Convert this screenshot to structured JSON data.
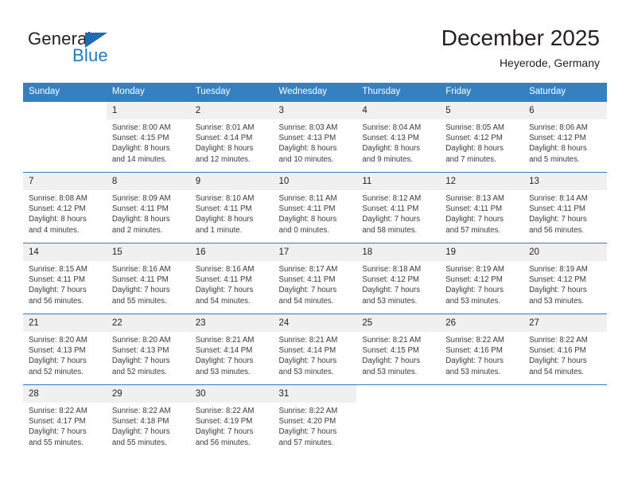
{
  "brand": {
    "line1": "General",
    "line2": "Blue",
    "accent_color": "#1f7ac4",
    "triangle_color": "#1d6cb3"
  },
  "header": {
    "title": "December 2025",
    "subtitle": "Heyerode, Germany"
  },
  "theme": {
    "header_row_bg": "#3580c0",
    "header_row_text": "#ffffff",
    "daynum_bg": "#f0f0f0",
    "row_divider": "#2f7cbe",
    "body_text": "#3a3a3a"
  },
  "weekdays": [
    "Sunday",
    "Monday",
    "Tuesday",
    "Wednesday",
    "Thursday",
    "Friday",
    "Saturday"
  ],
  "labels": {
    "sunrise_prefix": "Sunrise:",
    "sunset_prefix": "Sunset:",
    "daylight_prefix": "Daylight:"
  },
  "weeks": [
    [
      {
        "empty": true
      },
      {
        "day": "1",
        "sunrise": "Sunrise: 8:00 AM",
        "sunset": "Sunset: 4:15 PM",
        "daylight_line1": "Daylight: 8 hours",
        "daylight_line2": "and 14 minutes."
      },
      {
        "day": "2",
        "sunrise": "Sunrise: 8:01 AM",
        "sunset": "Sunset: 4:14 PM",
        "daylight_line1": "Daylight: 8 hours",
        "daylight_line2": "and 12 minutes."
      },
      {
        "day": "3",
        "sunrise": "Sunrise: 8:03 AM",
        "sunset": "Sunset: 4:13 PM",
        "daylight_line1": "Daylight: 8 hours",
        "daylight_line2": "and 10 minutes."
      },
      {
        "day": "4",
        "sunrise": "Sunrise: 8:04 AM",
        "sunset": "Sunset: 4:13 PM",
        "daylight_line1": "Daylight: 8 hours",
        "daylight_line2": "and 9 minutes."
      },
      {
        "day": "5",
        "sunrise": "Sunrise: 8:05 AM",
        "sunset": "Sunset: 4:12 PM",
        "daylight_line1": "Daylight: 8 hours",
        "daylight_line2": "and 7 minutes."
      },
      {
        "day": "6",
        "sunrise": "Sunrise: 8:06 AM",
        "sunset": "Sunset: 4:12 PM",
        "daylight_line1": "Daylight: 8 hours",
        "daylight_line2": "and 5 minutes."
      }
    ],
    [
      {
        "day": "7",
        "sunrise": "Sunrise: 8:08 AM",
        "sunset": "Sunset: 4:12 PM",
        "daylight_line1": "Daylight: 8 hours",
        "daylight_line2": "and 4 minutes."
      },
      {
        "day": "8",
        "sunrise": "Sunrise: 8:09 AM",
        "sunset": "Sunset: 4:11 PM",
        "daylight_line1": "Daylight: 8 hours",
        "daylight_line2": "and 2 minutes."
      },
      {
        "day": "9",
        "sunrise": "Sunrise: 8:10 AM",
        "sunset": "Sunset: 4:11 PM",
        "daylight_line1": "Daylight: 8 hours",
        "daylight_line2": "and 1 minute."
      },
      {
        "day": "10",
        "sunrise": "Sunrise: 8:11 AM",
        "sunset": "Sunset: 4:11 PM",
        "daylight_line1": "Daylight: 8 hours",
        "daylight_line2": "and 0 minutes."
      },
      {
        "day": "11",
        "sunrise": "Sunrise: 8:12 AM",
        "sunset": "Sunset: 4:11 PM",
        "daylight_line1": "Daylight: 7 hours",
        "daylight_line2": "and 58 minutes."
      },
      {
        "day": "12",
        "sunrise": "Sunrise: 8:13 AM",
        "sunset": "Sunset: 4:11 PM",
        "daylight_line1": "Daylight: 7 hours",
        "daylight_line2": "and 57 minutes."
      },
      {
        "day": "13",
        "sunrise": "Sunrise: 8:14 AM",
        "sunset": "Sunset: 4:11 PM",
        "daylight_line1": "Daylight: 7 hours",
        "daylight_line2": "and 56 minutes."
      }
    ],
    [
      {
        "day": "14",
        "sunrise": "Sunrise: 8:15 AM",
        "sunset": "Sunset: 4:11 PM",
        "daylight_line1": "Daylight: 7 hours",
        "daylight_line2": "and 56 minutes."
      },
      {
        "day": "15",
        "sunrise": "Sunrise: 8:16 AM",
        "sunset": "Sunset: 4:11 PM",
        "daylight_line1": "Daylight: 7 hours",
        "daylight_line2": "and 55 minutes."
      },
      {
        "day": "16",
        "sunrise": "Sunrise: 8:16 AM",
        "sunset": "Sunset: 4:11 PM",
        "daylight_line1": "Daylight: 7 hours",
        "daylight_line2": "and 54 minutes."
      },
      {
        "day": "17",
        "sunrise": "Sunrise: 8:17 AM",
        "sunset": "Sunset: 4:11 PM",
        "daylight_line1": "Daylight: 7 hours",
        "daylight_line2": "and 54 minutes."
      },
      {
        "day": "18",
        "sunrise": "Sunrise: 8:18 AM",
        "sunset": "Sunset: 4:12 PM",
        "daylight_line1": "Daylight: 7 hours",
        "daylight_line2": "and 53 minutes."
      },
      {
        "day": "19",
        "sunrise": "Sunrise: 8:19 AM",
        "sunset": "Sunset: 4:12 PM",
        "daylight_line1": "Daylight: 7 hours",
        "daylight_line2": "and 53 minutes."
      },
      {
        "day": "20",
        "sunrise": "Sunrise: 8:19 AM",
        "sunset": "Sunset: 4:12 PM",
        "daylight_line1": "Daylight: 7 hours",
        "daylight_line2": "and 53 minutes."
      }
    ],
    [
      {
        "day": "21",
        "sunrise": "Sunrise: 8:20 AM",
        "sunset": "Sunset: 4:13 PM",
        "daylight_line1": "Daylight: 7 hours",
        "daylight_line2": "and 52 minutes."
      },
      {
        "day": "22",
        "sunrise": "Sunrise: 8:20 AM",
        "sunset": "Sunset: 4:13 PM",
        "daylight_line1": "Daylight: 7 hours",
        "daylight_line2": "and 52 minutes."
      },
      {
        "day": "23",
        "sunrise": "Sunrise: 8:21 AM",
        "sunset": "Sunset: 4:14 PM",
        "daylight_line1": "Daylight: 7 hours",
        "daylight_line2": "and 53 minutes."
      },
      {
        "day": "24",
        "sunrise": "Sunrise: 8:21 AM",
        "sunset": "Sunset: 4:14 PM",
        "daylight_line1": "Daylight: 7 hours",
        "daylight_line2": "and 53 minutes."
      },
      {
        "day": "25",
        "sunrise": "Sunrise: 8:21 AM",
        "sunset": "Sunset: 4:15 PM",
        "daylight_line1": "Daylight: 7 hours",
        "daylight_line2": "and 53 minutes."
      },
      {
        "day": "26",
        "sunrise": "Sunrise: 8:22 AM",
        "sunset": "Sunset: 4:16 PM",
        "daylight_line1": "Daylight: 7 hours",
        "daylight_line2": "and 53 minutes."
      },
      {
        "day": "27",
        "sunrise": "Sunrise: 8:22 AM",
        "sunset": "Sunset: 4:16 PM",
        "daylight_line1": "Daylight: 7 hours",
        "daylight_line2": "and 54 minutes."
      }
    ],
    [
      {
        "day": "28",
        "sunrise": "Sunrise: 8:22 AM",
        "sunset": "Sunset: 4:17 PM",
        "daylight_line1": "Daylight: 7 hours",
        "daylight_line2": "and 55 minutes."
      },
      {
        "day": "29",
        "sunrise": "Sunrise: 8:22 AM",
        "sunset": "Sunset: 4:18 PM",
        "daylight_line1": "Daylight: 7 hours",
        "daylight_line2": "and 55 minutes."
      },
      {
        "day": "30",
        "sunrise": "Sunrise: 8:22 AM",
        "sunset": "Sunset: 4:19 PM",
        "daylight_line1": "Daylight: 7 hours",
        "daylight_line2": "and 56 minutes."
      },
      {
        "day": "31",
        "sunrise": "Sunrise: 8:22 AM",
        "sunset": "Sunset: 4:20 PM",
        "daylight_line1": "Daylight: 7 hours",
        "daylight_line2": "and 57 minutes."
      },
      {
        "empty": true
      },
      {
        "empty": true
      },
      {
        "empty": true
      }
    ]
  ]
}
